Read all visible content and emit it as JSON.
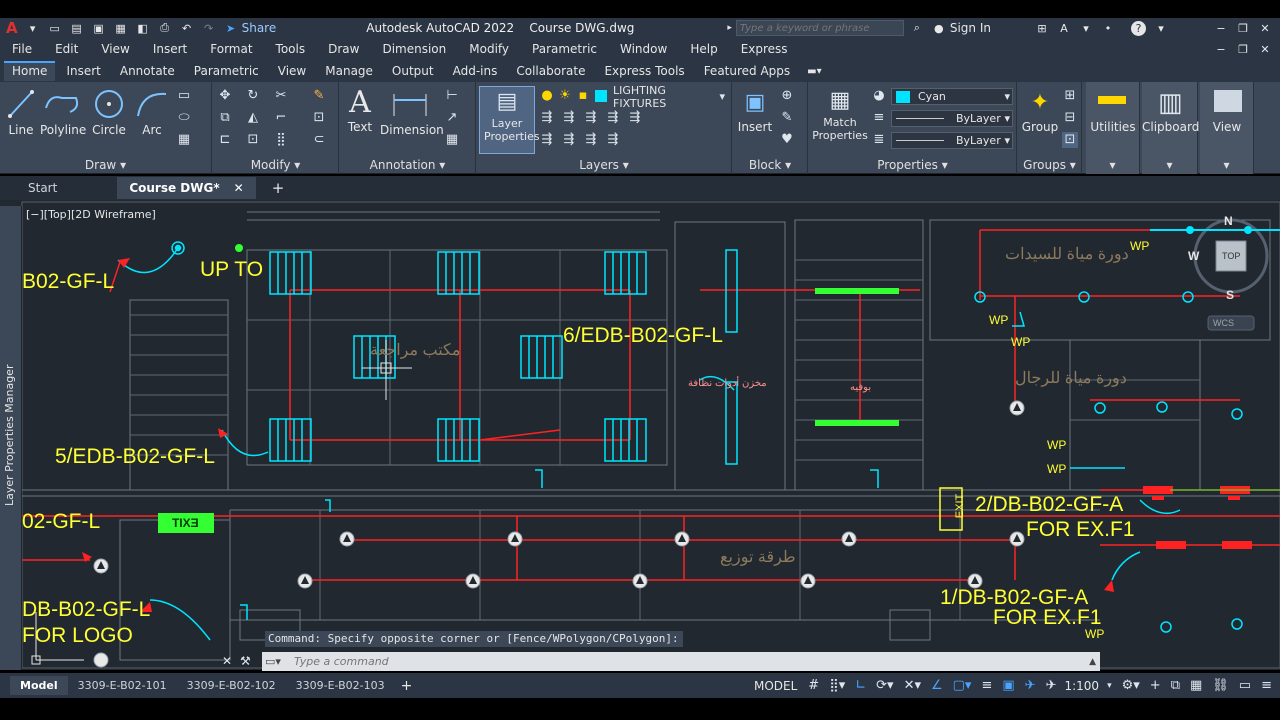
{
  "app": {
    "title": "Autodesk AutoCAD 2022    Course DWG.dwg",
    "logo": "A",
    "share": "Share",
    "search_placeholder": "Type a keyword or phrase",
    "sign_in": "Sign In",
    "help": "?"
  },
  "menu": [
    "File",
    "Edit",
    "View",
    "Insert",
    "Format",
    "Tools",
    "Draw",
    "Dimension",
    "Modify",
    "Parametric",
    "Window",
    "Help",
    "Express"
  ],
  "ribbon_tabs": [
    "Home",
    "Insert",
    "Annotate",
    "Parametric",
    "View",
    "Manage",
    "Output",
    "Add-ins",
    "Collaborate",
    "Express Tools",
    "Featured Apps"
  ],
  "ribbon": {
    "draw": {
      "title": "Draw",
      "line": "Line",
      "polyline": "Polyline",
      "circle": "Circle",
      "arc": "Arc"
    },
    "modify": {
      "title": "Modify"
    },
    "annotation": {
      "title": "Annotation",
      "text": "Text",
      "dimension": "Dimension"
    },
    "layers": {
      "title": "Layers",
      "layer_properties": "Layer Properties",
      "current_layer": "LIGHTING FIXTURES"
    },
    "block": {
      "title": "Block",
      "insert": "Insert"
    },
    "properties": {
      "title": "Properties",
      "match": "Match Properties",
      "color": "Cyan",
      "linetype": "ByLayer",
      "lineweight": "ByLayer"
    },
    "groups": {
      "title": "Groups",
      "group": "Group"
    },
    "utilities": "Utilities",
    "clipboard": "Clipboard",
    "view": "View"
  },
  "doc_tabs": {
    "start": "Start",
    "active": "Course DWG*"
  },
  "viewport_label": "[−][Top][2D Wireframe]",
  "side_panel": "Layer Properties Manager",
  "viewcube": {
    "n": "N",
    "w": "W",
    "s": "S",
    "top": "TOP",
    "wcs": "WCS"
  },
  "drawing": {
    "labels": {
      "b02_gf_l": "B02-GF-L",
      "up_to": "UP TO",
      "edb6": "6/EDB-B02-GF-L",
      "edb5": "5/EDB-B02-GF-L",
      "gf_l": "02-GF-L",
      "db_logo": "DB-B02-GF-L",
      "for_logo": "FOR LOGO",
      "db2": "2/DB-B02-GF-A",
      "db2_for": "FOR EX.F1",
      "db1": "1/DB-B02-GF-A",
      "db1_for": "FOR EX.F1",
      "exit": "EXIT",
      "wp": "WP"
    },
    "arabic": {
      "office": "مكتب مراجعة",
      "wc_men": "دورة مياة للسيدات",
      "wc_women": "دورة مياة للرجال",
      "corridor": "طرقة توزيع",
      "store": "مخزن أدوات نظافة",
      "room": "بوفيه"
    }
  },
  "command": {
    "history": "Command: Specify opposite corner or [Fence/WPolygon/CPolygon]:",
    "placeholder": "Type a command"
  },
  "layouts": [
    "Model",
    "3309-E-B02-101",
    "3309-E-B02-102",
    "3309-E-B02-103"
  ],
  "status": {
    "model": "MODEL",
    "scale": "1:100"
  },
  "colors": {
    "accent": "#4aa4ff",
    "cyan": "#00e5ff",
    "red": "#ff2222",
    "yellow": "#ffff33",
    "green": "#33ff33"
  }
}
